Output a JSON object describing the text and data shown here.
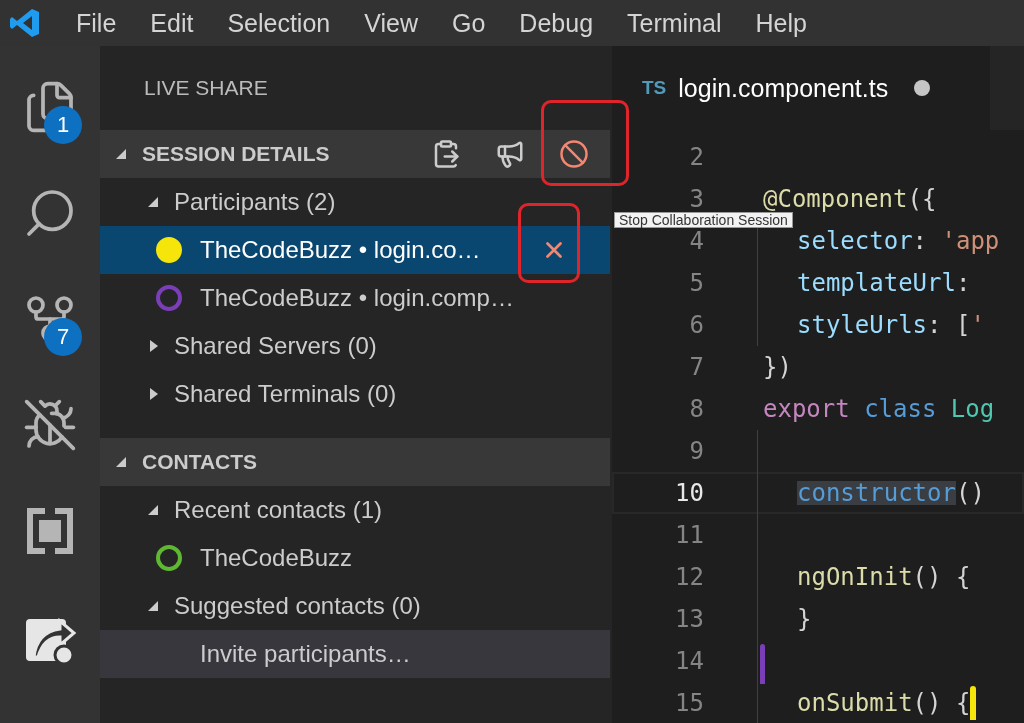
{
  "menu_bar": {
    "items": [
      "File",
      "Edit",
      "Selection",
      "View",
      "Go",
      "Debug",
      "Terminal",
      "Help"
    ]
  },
  "activity_bar": {
    "items": [
      {
        "kind": "files",
        "badge": "1"
      },
      {
        "kind": "search"
      },
      {
        "kind": "source-control",
        "badge": "7"
      },
      {
        "kind": "debug"
      },
      {
        "kind": "extensions"
      },
      {
        "kind": "live-share"
      }
    ]
  },
  "sidebar": {
    "title": "LIVE SHARE",
    "sections": [
      {
        "title": "SESSION DETAILS",
        "expanded": true,
        "actions": [
          {
            "kind": "clipboard",
            "annotated": false
          },
          {
            "kind": "megaphone",
            "annotated": false
          },
          {
            "kind": "stop",
            "annotated": true
          }
        ],
        "groups": [
          {
            "label": "Participants (2)",
            "expanded": true,
            "children": [
              {
                "label": "TheCodeBuzz • login.co…",
                "color": "#f5e50a",
                "filled": true,
                "selected": true,
                "close": {
                  "annotated": true
                }
              },
              {
                "label": "TheCodeBuzz • login.comp…",
                "color": "#7a3fb8",
                "filled": false,
                "selected": false
              }
            ]
          },
          {
            "label": "Shared Servers (0)",
            "expanded": false
          },
          {
            "label": "Shared Terminals (0)",
            "expanded": false
          }
        ]
      },
      {
        "title": "CONTACTS",
        "expanded": true,
        "groups": [
          {
            "label": "Recent contacts (1)",
            "expanded": true,
            "children": [
              {
                "label": "TheCodeBuzz",
                "color": "#5fb832",
                "filled": false,
                "selected": false
              }
            ]
          },
          {
            "label": "Suggested contacts (0)",
            "expanded": true
          }
        ],
        "footer": {
          "label": "Invite participants…"
        }
      }
    ]
  },
  "tooltip": {
    "text": "Stop Collaboration Session"
  },
  "editor": {
    "tab": {
      "badge": "TS",
      "title": "login.component.ts",
      "modified": true
    },
    "lines": [
      {
        "number": "2",
        "current": false,
        "indented": false
      },
      {
        "number": "3",
        "current": false,
        "indented": false,
        "tokens": [
          {
            "kind": "decorator",
            "text": "@Component"
          },
          {
            "kind": "plain",
            "text": "({"
          }
        ]
      },
      {
        "number": "4",
        "current": false,
        "indented": true,
        "tokens": [
          {
            "kind": "property",
            "text": "selector"
          },
          {
            "kind": "plain",
            "text": ": "
          },
          {
            "kind": "string",
            "text": "'app"
          }
        ]
      },
      {
        "number": "5",
        "current": false,
        "indented": true,
        "tokens": [
          {
            "kind": "property",
            "text": "templateUrl"
          },
          {
            "kind": "plain",
            "text": ":"
          }
        ]
      },
      {
        "number": "6",
        "current": false,
        "indented": true,
        "tokens": [
          {
            "kind": "property",
            "text": "styleUrls"
          },
          {
            "kind": "plain",
            "text": ": ["
          },
          {
            "kind": "string",
            "text": "'"
          }
        ]
      },
      {
        "number": "7",
        "current": false,
        "indented": false,
        "tokens": [
          {
            "kind": "plain",
            "text": "})"
          }
        ]
      },
      {
        "number": "8",
        "current": false,
        "indented": false,
        "tokens": [
          {
            "kind": "keyword",
            "text": "export "
          },
          {
            "kind": "storage",
            "text": "class "
          },
          {
            "kind": "type",
            "text": "Log"
          }
        ]
      },
      {
        "number": "9",
        "current": false,
        "indented": true
      },
      {
        "number": "10",
        "current": true,
        "indented": true,
        "tokens": [
          {
            "kind": "selected",
            "text": "constructor"
          },
          {
            "kind": "plain",
            "text": "()"
          }
        ]
      },
      {
        "number": "11",
        "current": false,
        "indented": true
      },
      {
        "number": "12",
        "current": false,
        "indented": true,
        "tokens": [
          {
            "kind": "function",
            "text": "ngOnInit"
          },
          {
            "kind": "plain",
            "text": "() {"
          }
        ]
      },
      {
        "number": "13",
        "current": false,
        "indented": true,
        "tokens": [
          {
            "kind": "plain",
            "text": "}"
          }
        ]
      },
      {
        "number": "14",
        "current": false,
        "indented": true,
        "gutter_cursor": {
          "color": "#7a3fb8"
        }
      },
      {
        "number": "15",
        "current": false,
        "indented": true,
        "tokens": [
          {
            "kind": "function",
            "text": "onSubmit"
          },
          {
            "kind": "plain",
            "text": "() {"
          },
          {
            "kind": "cursor",
            "color": "#f5e50a"
          }
        ]
      }
    ]
  }
}
